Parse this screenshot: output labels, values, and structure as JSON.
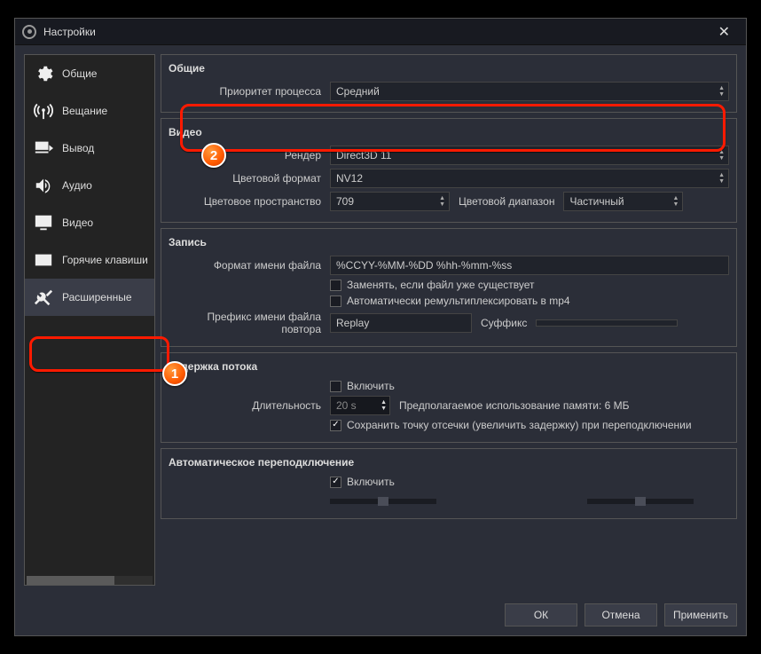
{
  "window": {
    "title": "Настройки"
  },
  "sidebar": {
    "items": [
      {
        "label": "Общие"
      },
      {
        "label": "Вещание"
      },
      {
        "label": "Вывод"
      },
      {
        "label": "Аудио"
      },
      {
        "label": "Видео"
      },
      {
        "label": "Горячие клавиши"
      },
      {
        "label": "Расширенные"
      }
    ]
  },
  "groups": {
    "general": {
      "title": "Общие",
      "priority_label": "Приоритет процесса",
      "priority_value": "Средний"
    },
    "video": {
      "title": "Видео",
      "renderer_label": "Рендер",
      "renderer_value": "Direct3D 11",
      "color_format_label": "Цветовой формат",
      "color_format_value": "NV12",
      "color_space_label": "Цветовое пространство",
      "color_space_value": "709",
      "color_range_label": "Цветовой диапазон",
      "color_range_value": "Частичный"
    },
    "recording": {
      "title": "Запись",
      "filename_format_label": "Формат имени файла",
      "filename_format_value": "%CCYY-%MM-%DD %hh-%mm-%ss",
      "overwrite_label": "Заменять, если файл уже существует",
      "remux_label": "Автоматически ремультиплексировать в mp4",
      "replay_prefix_label": "Префикс имени файла повтора",
      "replay_prefix_value": "Replay",
      "suffix_label": "Суффикс",
      "suffix_value": ""
    },
    "delay": {
      "title": "Задержка потока",
      "enable_label": "Включить",
      "duration_label": "Длительность",
      "duration_value": "20 s",
      "memory_estimate": "Предполагаемое использование памяти: 6 МБ",
      "preserve_label": "Сохранить точку отсечки (увеличить задержку) при переподключении"
    },
    "reconnect": {
      "title": "Автоматическое переподключение",
      "enable_label": "Включить"
    }
  },
  "footer": {
    "ok": "ОК",
    "cancel": "Отмена",
    "apply": "Применить"
  },
  "badges": {
    "one": "1",
    "two": "2"
  }
}
